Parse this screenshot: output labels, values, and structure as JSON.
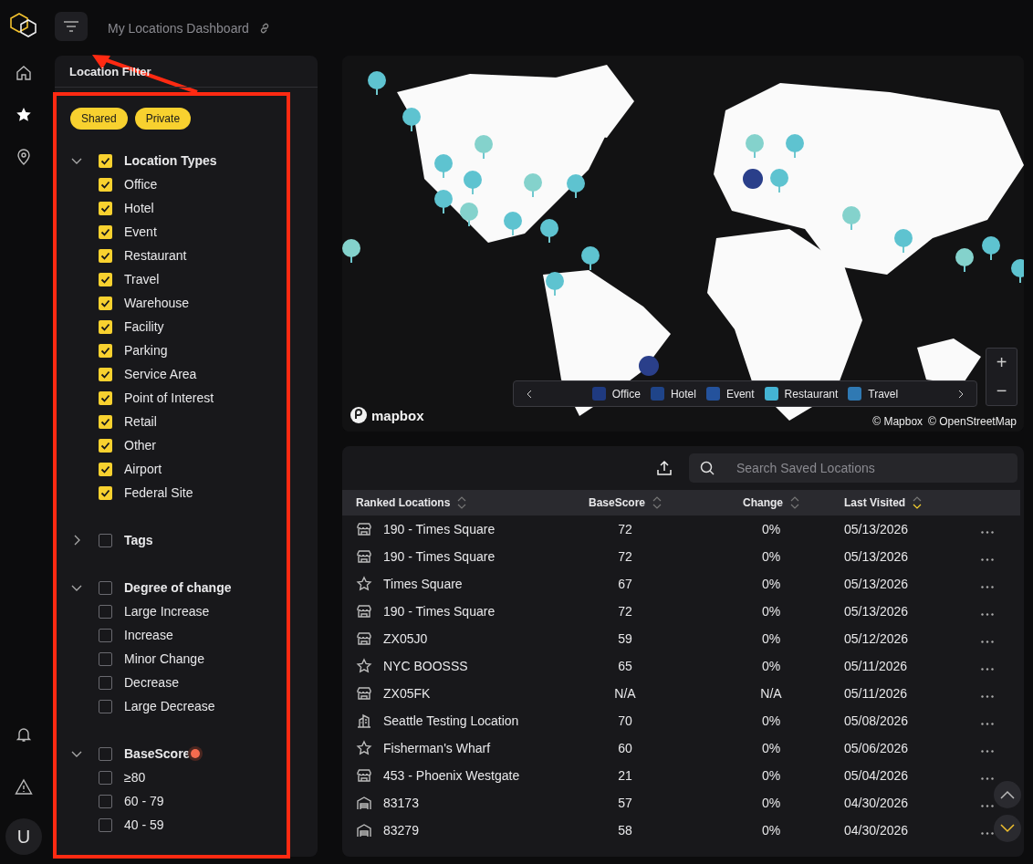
{
  "header": {
    "title": "My Locations Dashboard"
  },
  "filter": {
    "title": "Location Filter",
    "chips": [
      "Shared",
      "Private"
    ],
    "groups": [
      {
        "label": "Location Types",
        "expanded": true,
        "checked": true,
        "alert": false,
        "children": [
          {
            "label": "Office",
            "checked": true
          },
          {
            "label": "Hotel",
            "checked": true
          },
          {
            "label": "Event",
            "checked": true
          },
          {
            "label": "Restaurant",
            "checked": true
          },
          {
            "label": "Travel",
            "checked": true
          },
          {
            "label": "Warehouse",
            "checked": true
          },
          {
            "label": "Facility",
            "checked": true
          },
          {
            "label": "Parking",
            "checked": true
          },
          {
            "label": "Service Area",
            "checked": true
          },
          {
            "label": "Point of Interest",
            "checked": true
          },
          {
            "label": "Retail",
            "checked": true
          },
          {
            "label": "Other",
            "checked": true
          },
          {
            "label": "Airport",
            "checked": true
          },
          {
            "label": "Federal Site",
            "checked": true
          }
        ]
      },
      {
        "label": "Tags",
        "expanded": false,
        "checked": false,
        "alert": false
      },
      {
        "label": "Degree of change",
        "expanded": true,
        "checked": false,
        "alert": false,
        "children": [
          {
            "label": "Large Increase",
            "checked": false
          },
          {
            "label": "Increase",
            "checked": false
          },
          {
            "label": "Minor Change",
            "checked": false
          },
          {
            "label": "Decrease",
            "checked": false
          },
          {
            "label": "Large Decrease",
            "checked": false
          }
        ]
      },
      {
        "label": "BaseScore",
        "expanded": true,
        "checked": false,
        "alert": true,
        "children": [
          {
            "label": "≥80",
            "checked": false
          },
          {
            "label": "60 - 79",
            "checked": false
          },
          {
            "label": "40 - 59",
            "checked": false
          }
        ]
      }
    ]
  },
  "map": {
    "kind": "picture",
    "brand": "mapbox",
    "attribution": [
      "© Mapbox",
      "© OpenStreetMap"
    ],
    "legend": [
      {
        "label": "Office",
        "color": "#1f3a80"
      },
      {
        "label": "Hotel",
        "color": "#1f4489"
      },
      {
        "label": "Event",
        "color": "#24529c"
      },
      {
        "label": "Restaurant",
        "color": "#44b3d3"
      },
      {
        "label": "Travel",
        "color": "#2f79b3"
      }
    ],
    "zoom": [
      "+",
      "−"
    ]
  },
  "table": {
    "search": {
      "placeholder": "Search Saved Locations"
    },
    "columns": [
      {
        "label": "Ranked Locations",
        "sorted": false
      },
      {
        "label": "BaseScore",
        "sorted": false
      },
      {
        "label": "Change",
        "sorted": false
      },
      {
        "label": "Last Visited",
        "sorted": true
      }
    ],
    "rows": [
      {
        "kind": "store",
        "name": "190 - Times Square",
        "score": "72",
        "change": "0%",
        "visited": "05/13/2026"
      },
      {
        "kind": "store",
        "name": "190 - Times Square",
        "score": "72",
        "change": "0%",
        "visited": "05/13/2026"
      },
      {
        "kind": "star",
        "name": "Times Square",
        "score": "67",
        "change": "0%",
        "visited": "05/13/2026"
      },
      {
        "kind": "store",
        "name": "190 - Times Square",
        "score": "72",
        "change": "0%",
        "visited": "05/13/2026"
      },
      {
        "kind": "store",
        "name": "ZX05J0",
        "score": "59",
        "change": "0%",
        "visited": "05/12/2026"
      },
      {
        "kind": "star",
        "name": "NYC BOOSSS",
        "score": "65",
        "change": "0%",
        "visited": "05/11/2026"
      },
      {
        "kind": "store",
        "name": "ZX05FK",
        "score": "N/A",
        "change": "N/A",
        "visited": "05/11/2026"
      },
      {
        "kind": "building",
        "name": "Seattle Testing Location",
        "score": "70",
        "change": "0%",
        "visited": "05/08/2026"
      },
      {
        "kind": "star",
        "name": "Fisherman's Wharf",
        "score": "60",
        "change": "0%",
        "visited": "05/06/2026"
      },
      {
        "kind": "store",
        "name": "453 - Phoenix Westgate",
        "score": "21",
        "change": "0%",
        "visited": "05/04/2026"
      },
      {
        "kind": "warehouse",
        "name": "83173",
        "score": "57",
        "change": "0%",
        "visited": "04/30/2026"
      },
      {
        "kind": "warehouse",
        "name": "83279",
        "score": "58",
        "change": "0%",
        "visited": "04/30/2026"
      }
    ]
  },
  "user": {
    "initial": "U"
  }
}
